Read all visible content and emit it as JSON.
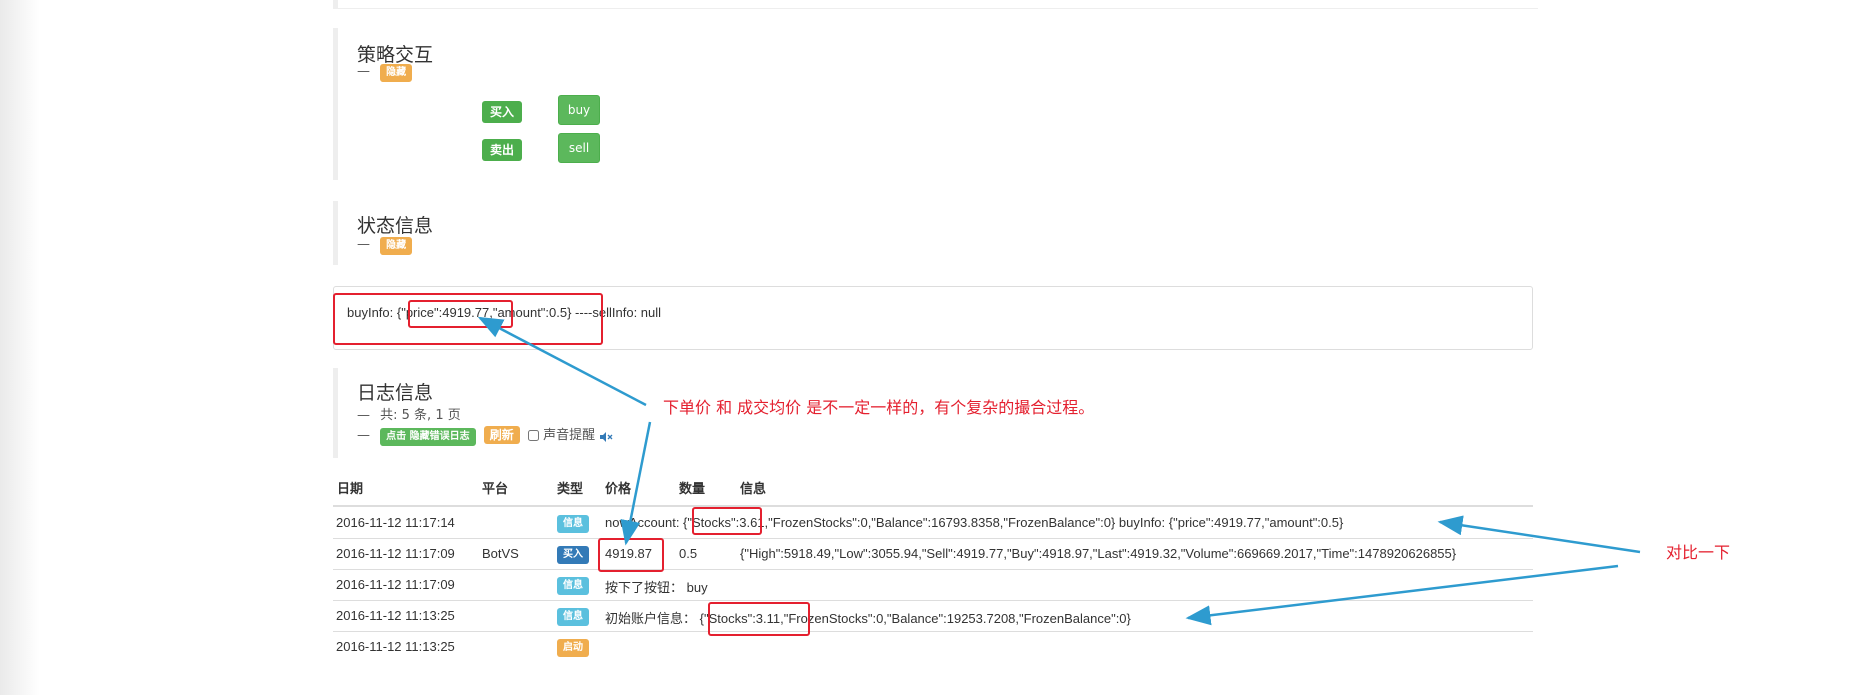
{
  "panels": {
    "interaction": {
      "title": "策略交互",
      "dash": "—",
      "hide_label": "隐藏",
      "buttons": [
        {
          "tag": "买入",
          "button": "buy"
        },
        {
          "tag": "卖出",
          "button": "sell"
        }
      ]
    },
    "status": {
      "title": "状态信息",
      "dash": "—",
      "hide_label": "隐藏",
      "text": "buyInfo: {\"price\":4919.77,\"amount\":0.5} ----sellInfo: null"
    },
    "log": {
      "title": "日志信息",
      "dash": "—",
      "count_text": "共: 5 条, 1 页",
      "hide_error_label": "点击 隐藏错误日志",
      "refresh_label": "刷新",
      "sound_label": "声音提醒",
      "sound_icon": "speaker-mute-icon"
    }
  },
  "log_table": {
    "headers": [
      "日期",
      "平台",
      "类型",
      "价格",
      "数量",
      "信息"
    ],
    "rows": [
      {
        "date": "2016-11-12 11:17:14",
        "platform": "",
        "type": "信息",
        "type_color": "#5bc0de",
        "price": "",
        "amount": "",
        "info": "nowAccount: {\"Stocks\":3.61,\"FrozenStocks\":0,\"Balance\":16793.8358,\"FrozenBalance\":0} buyInfo: {\"price\":4919.77,\"amount\":0.5}"
      },
      {
        "date": "2016-11-12 11:17:09",
        "platform": "BotVS",
        "type": "买入",
        "type_color": "#337ab7",
        "price": "4919.87",
        "amount": "0.5",
        "info": "{\"High\":5918.49,\"Low\":3055.94,\"Sell\":4919.77,\"Buy\":4918.97,\"Last\":4919.32,\"Volume\":669669.2017,\"Time\":1478920626855}"
      },
      {
        "date": "2016-11-12 11:17:09",
        "platform": "",
        "type": "信息",
        "type_color": "#5bc0de",
        "price": "",
        "amount": "",
        "info": "按下了按钮： buy"
      },
      {
        "date": "2016-11-12 11:13:25",
        "platform": "",
        "type": "信息",
        "type_color": "#5bc0de",
        "price": "",
        "amount": "",
        "info": "初始账户信息：  {\"Stocks\":3.11,\"FrozenStocks\":0,\"Balance\":19253.7208,\"FrozenBalance\":0}"
      },
      {
        "date": "2016-11-12 11:13:25",
        "platform": "",
        "type": "启动",
        "type_color": "#f0ad4e",
        "price": "",
        "amount": "",
        "info": ""
      }
    ]
  },
  "annotations": {
    "note1": "下单价  和  成交均价 是不一定一样的，有个复杂的撮合过程。",
    "note2": "对比一下"
  },
  "colors": {
    "annotation_red": "#e4202f",
    "arrow_blue": "#2e9bcf",
    "button_green": "#5cb85c",
    "label_orange": "#f0ad4e"
  }
}
